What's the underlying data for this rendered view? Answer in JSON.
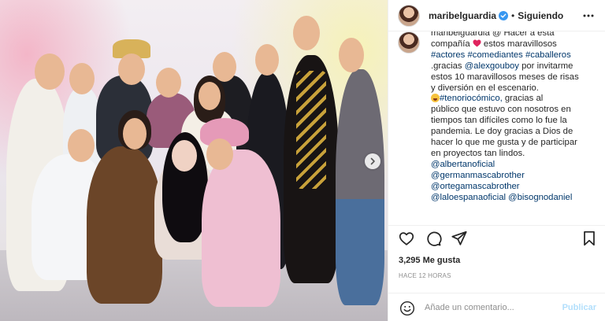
{
  "post": {
    "username": "maribelguardia",
    "follow_state": "Siguiendo",
    "separator": "•"
  },
  "caption": {
    "lines": [
      "maribelguardia @ Hacer a esta",
      "compañía",
      "estos maravillosos",
      "#actores #comediantes #caballeros",
      ".gracias",
      "@alexgouboy",
      "por invitarme",
      "estos 10 maravillosos meses de risas",
      "y diversión en el escenario.",
      "#tenoriocómico,",
      "gracias al",
      "público que estuvo con nosotros en",
      "tiempos tan difíciles como lo fue la",
      "pandemia. Le doy gracias a Dios de",
      "hacer lo que me gusta y de participar",
      "en proyectos tan lindos.",
      "@albertanoficial",
      "@germanmascabrother",
      "@ortegamascabrother",
      "@laloespanaoficial",
      "@bisognodaniel"
    ]
  },
  "stats": {
    "likes": "3,295 Me gusta",
    "time": "HACE 12 HORAS"
  },
  "comment": {
    "placeholder": "Añade un comentario...",
    "publish": "Publicar"
  },
  "colors": {
    "link": "#00376b",
    "heart": "#e0245e",
    "verified": "#3897f0",
    "publish_disabled": "#b2dffc"
  },
  "icons": {
    "verified": "verified-badge-icon",
    "more": "more-options-icon",
    "like": "heart-icon",
    "comment": "comment-icon",
    "share": "paper-plane-icon",
    "save": "bookmark-icon",
    "emoji": "emoji-icon",
    "next": "chevron-right-icon"
  }
}
